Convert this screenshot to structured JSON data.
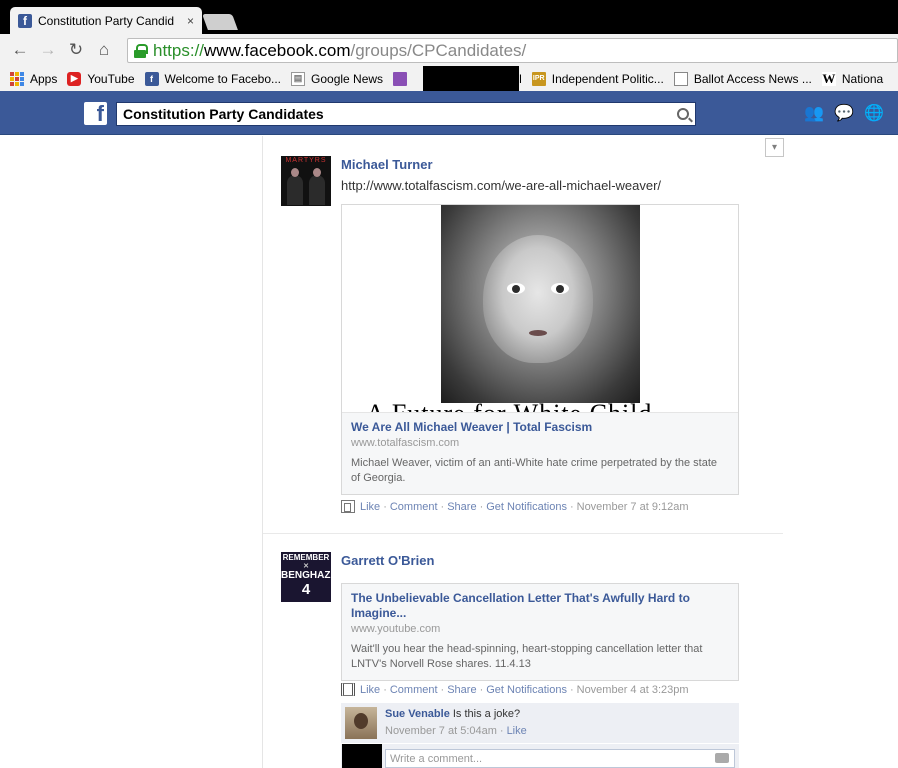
{
  "browser": {
    "tab_title": "Constitution Party Candid",
    "tab_close": "×",
    "url_scheme": "https://",
    "url_host": "www.facebook.com",
    "url_path": "/groups/CPCandidates/",
    "nav_back": "←",
    "nav_forward": "→",
    "nav_reload": "↻",
    "nav_home": "⌂"
  },
  "bookmarks": [
    {
      "label": "Apps",
      "icon": "apps-grid-icon"
    },
    {
      "label": "YouTube",
      "icon": "youtube-icon"
    },
    {
      "label": "Welcome to Facebo...",
      "icon": "facebook-icon"
    },
    {
      "label": "Google News",
      "icon": "google-news-icon"
    },
    {
      "label": "",
      "icon": "mail-icon"
    },
    {
      "label": "l",
      "icon": "redacted"
    },
    {
      "label": "Independent Politic...",
      "icon": "ipr-icon"
    },
    {
      "label": "Ballot Access News ...",
      "icon": "document-icon"
    },
    {
      "label": "Nationa",
      "icon": "wikipedia-icon"
    }
  ],
  "bookmark_icon_text": {
    "facebook": "f",
    "news": "▤",
    "ipr": "IPR",
    "wiki": "W",
    "youtube": "▶"
  },
  "facebook": {
    "logo": "f",
    "search_value": "Constitution Party Candidates",
    "jewels": [
      "friend-requests-icon",
      "messages-icon",
      "notifications-icon"
    ]
  },
  "posts": [
    {
      "author": "Michael Turner",
      "avatar_text": "MARTYRS",
      "text": "http://www.totalfascism.com/we-are-all-michael-weaver/",
      "image_caption": "A Future for White Child",
      "link_title": "We Are All Michael Weaver | Total Fascism",
      "link_domain": "www.totalfascism.com",
      "link_desc": "Michael Weaver, victim of an anti-White hate crime perpetrated by the state of Georgia.",
      "actions": [
        "Like",
        "Comment",
        "Share",
        "Get Notifications"
      ],
      "timestamp": "November 7 at 9:12am"
    },
    {
      "author": "Garrett O'Brien",
      "avatar_lines": [
        "REMEMBER",
        "✕",
        "BENGHAZI",
        "4"
      ],
      "link_title": "The Unbelievable Cancellation Letter That's Awfully Hard to Imagine...",
      "link_domain": "www.youtube.com",
      "link_desc": "Wait'll you hear the head-spinning, heart-stopping cancellation letter that LNTV's Norvell Rose shares. 11.4.13",
      "actions": [
        "Like",
        "Comment",
        "Share",
        "Get Notifications"
      ],
      "timestamp": "November 4 at 3:23pm",
      "comment": {
        "author": "Sue Venable",
        "text": "Is this a joke?",
        "time": "November 7 at 5:04am",
        "like": "Like"
      },
      "write_placeholder": "Write a comment..."
    }
  ],
  "sep": "·",
  "caret": "▾"
}
